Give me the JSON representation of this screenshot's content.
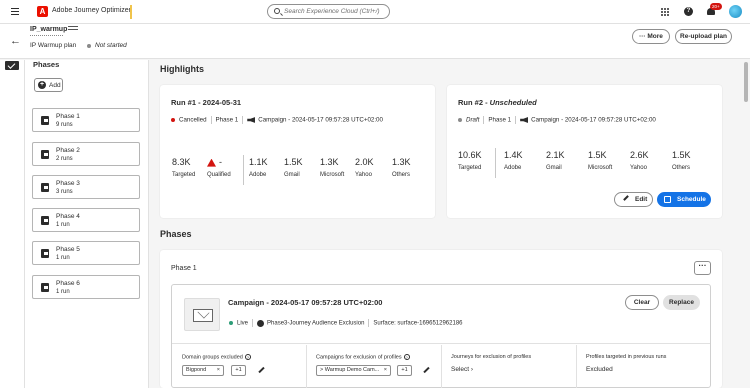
{
  "topbar": {
    "app_name": "Adobe Journey Optimizer",
    "logo_letter": "A",
    "search_placeholder": "Search Experience Cloud (Ctrl+/)",
    "notification_count": "20+"
  },
  "header": {
    "title": "IP_warmup",
    "subtitle": "IP Warmup plan",
    "status": "Not started",
    "more_label": "More",
    "reupload_label": "Re-upload plan"
  },
  "sidebar": {
    "title": "Phases",
    "add_label": "Add",
    "phases": [
      {
        "name": "Phase 1",
        "runs": "9 runs"
      },
      {
        "name": "Phase 2",
        "runs": "2 runs"
      },
      {
        "name": "Phase 3",
        "runs": "3 runs"
      },
      {
        "name": "Phase 4",
        "runs": "1 run"
      },
      {
        "name": "Phase 5",
        "runs": "1 run"
      },
      {
        "name": "Phase 6",
        "runs": "1 run"
      }
    ]
  },
  "highlights": {
    "title": "Highlights",
    "run1": {
      "title": "Run #1 - 2024-05-31",
      "status": "Cancelled",
      "status_color": "#d31510",
      "phase": "Phase 1",
      "campaign": "Campaign - 2024-05-17 09:57:28 UTC+02:00",
      "stats": [
        {
          "value": "8.3K",
          "label": "Targeted"
        },
        {
          "value": "-",
          "label": "Qualified"
        },
        {
          "value": "1.1K",
          "label": "Adobe"
        },
        {
          "value": "1.5K",
          "label": "Gmail"
        },
        {
          "value": "1.3K",
          "label": "Microsoft"
        },
        {
          "value": "2.0K",
          "label": "Yahoo"
        },
        {
          "value": "1.3K",
          "label": "Others"
        }
      ]
    },
    "run2": {
      "title_prefix": "Run #2 - ",
      "title_status": "Unscheduled",
      "status": "Draft",
      "status_color": "#8a8a8a",
      "phase": "Phase 1",
      "campaign": "Campaign - 2024-05-17 09:57:28 UTC+02:00",
      "stats": [
        {
          "value": "10.6K",
          "label": "Targeted"
        },
        {
          "value": "1.4K",
          "label": "Adobe"
        },
        {
          "value": "2.1K",
          "label": "Gmail"
        },
        {
          "value": "1.5K",
          "label": "Microsoft"
        },
        {
          "value": "2.6K",
          "label": "Yahoo"
        },
        {
          "value": "1.5K",
          "label": "Others"
        }
      ],
      "edit_label": "Edit",
      "schedule_label": "Schedule"
    }
  },
  "phases_section": {
    "title": "Phases",
    "phase_title": "Phase 1",
    "more_glyph": "···",
    "campaign": {
      "name": "Campaign - 2024-05-17 09:57:28 UTC+02:00",
      "status": "Live",
      "status_color": "#2d9d78",
      "journey": "Phase3-Journey Audience Exclusion",
      "surface": "Surface: surface-1696512962186",
      "clear_label": "Clear",
      "replace_label": "Replace"
    },
    "columns": {
      "domain_groups_label": "Domain groups excluded",
      "domain_tag": "Bigpond",
      "domain_more": "+1",
      "campaigns_label": "Campaigns for exclusion of profiles",
      "campaign_tag": "> Warmup Demo Cam...",
      "campaign_more": "+1",
      "journeys_label": "Journeys for exclusion of profiles",
      "journeys_value": "Select",
      "profiles_label": "Profiles targeted in previous runs",
      "profiles_value": "Excluded"
    }
  },
  "colors": {
    "accent": "#1473e6",
    "brand": "#eb1000"
  }
}
